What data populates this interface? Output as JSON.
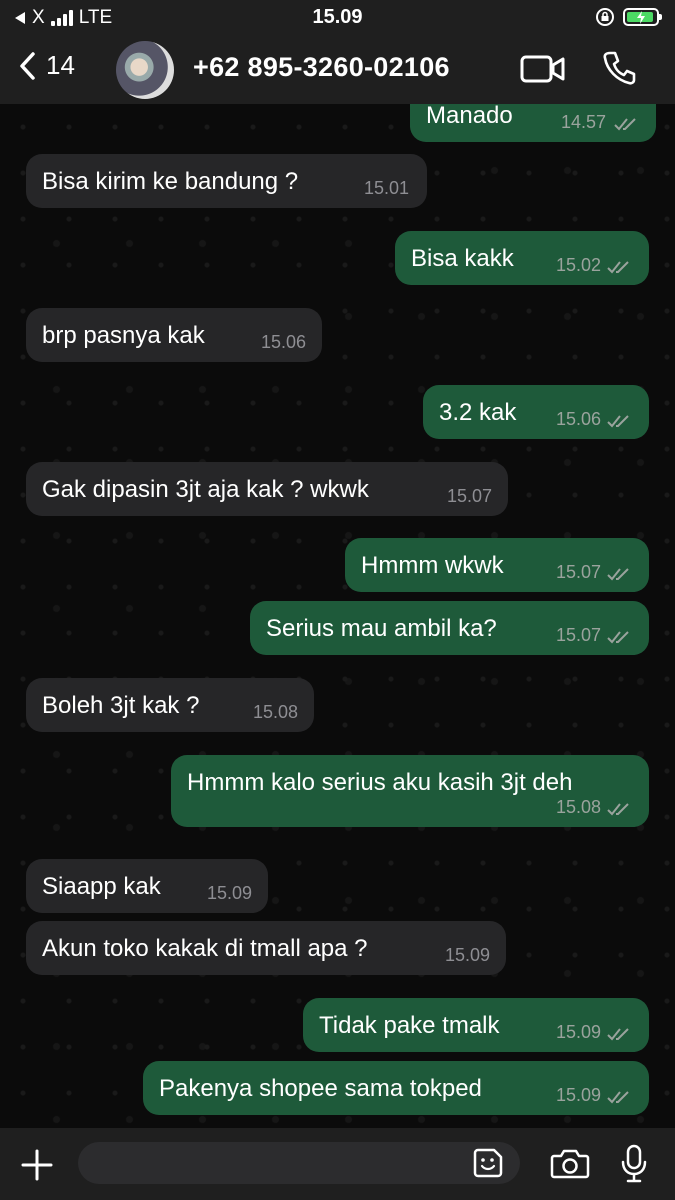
{
  "status": {
    "carrier": "X",
    "network": "LTE",
    "time": "15.09"
  },
  "header": {
    "back_count": "14",
    "contact_name": "+62 895-3260-02106"
  },
  "messages": [
    {
      "dir": "out",
      "text": "Manado",
      "time": "14.57",
      "read": true,
      "partial": true
    },
    {
      "dir": "in",
      "text": "Bisa kirim ke bandung ?",
      "time": "15.01"
    },
    {
      "dir": "out",
      "text": "Bisa kakk",
      "time": "15.02",
      "read": true
    },
    {
      "dir": "in",
      "text": "brp pasnya kak",
      "time": "15.06"
    },
    {
      "dir": "out",
      "text": "3.2 kak",
      "time": "15.06",
      "read": true
    },
    {
      "dir": "in",
      "text": "Gak dipasin 3jt aja kak ? wkwk",
      "time": "15.07"
    },
    {
      "dir": "out",
      "text": "Hmmm wkwk",
      "time": "15.07",
      "read": true
    },
    {
      "dir": "out",
      "text": "Serius mau ambil ka?",
      "time": "15.07",
      "read": true
    },
    {
      "dir": "in",
      "text": "Boleh 3jt kak ?",
      "time": "15.08"
    },
    {
      "dir": "out",
      "text": "Hmmm kalo serius aku kasih 3jt deh",
      "time": "15.08",
      "read": true
    },
    {
      "dir": "in",
      "text": "Siaapp kak",
      "time": "15.09"
    },
    {
      "dir": "in",
      "text": "Akun toko kakak di tmall apa ?",
      "time": "15.09"
    },
    {
      "dir": "out",
      "text": "Tidak pake tmalk",
      "time": "15.09",
      "read": true
    },
    {
      "dir": "out",
      "text": "Pakenya shopee sama tokped",
      "time": "15.09",
      "read": true
    }
  ],
  "colors": {
    "outgoing_bubble": "#1e5a3a",
    "incoming_bubble": "#262628",
    "background": "#0b0b0b",
    "bar": "#1f1f1f"
  },
  "icons": [
    "back-chevron-icon",
    "video-call-icon",
    "phone-icon",
    "plus-icon",
    "sticker-icon",
    "camera-icon",
    "microphone-icon"
  ]
}
